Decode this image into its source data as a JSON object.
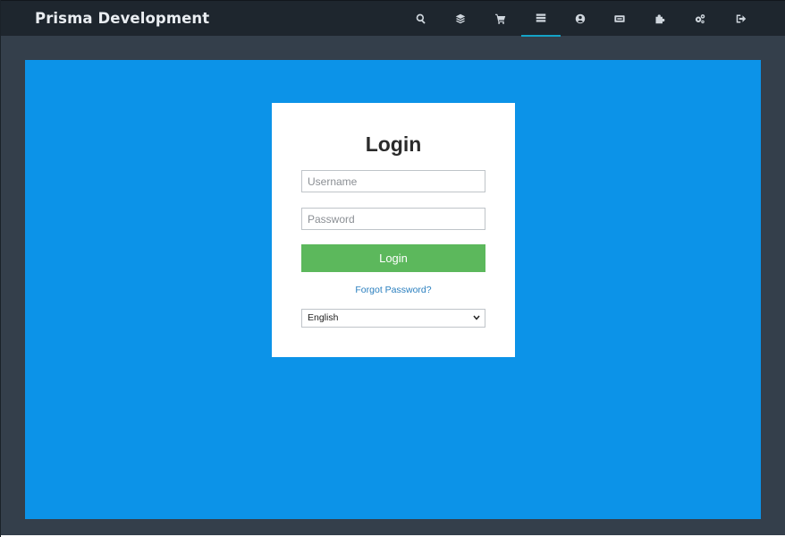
{
  "app": {
    "title": "Prisma Development"
  },
  "nav": {
    "items": [
      {
        "icon": "search-icon",
        "active": false
      },
      {
        "icon": "layers-icon",
        "active": false
      },
      {
        "icon": "cart-icon",
        "active": false
      },
      {
        "icon": "list-icon",
        "active": true
      },
      {
        "icon": "user-circle-icon",
        "active": false
      },
      {
        "icon": "ticket-icon",
        "active": false
      },
      {
        "icon": "puzzle-icon",
        "active": false
      },
      {
        "icon": "gears-icon",
        "active": false
      },
      {
        "icon": "sign-out-icon",
        "active": false
      }
    ]
  },
  "login": {
    "title": "Login",
    "username_placeholder": "Username",
    "password_placeholder": "Password",
    "button_label": "Login",
    "forgot_label": "Forgot Password?",
    "language": {
      "selected": "English"
    }
  },
  "colors": {
    "topbar": "#1e262e",
    "background": "#343f4b",
    "panel": "#0c93e8",
    "button": "#5cb85c",
    "link": "#2a7fbf",
    "active_indicator": "#14a3c7"
  }
}
